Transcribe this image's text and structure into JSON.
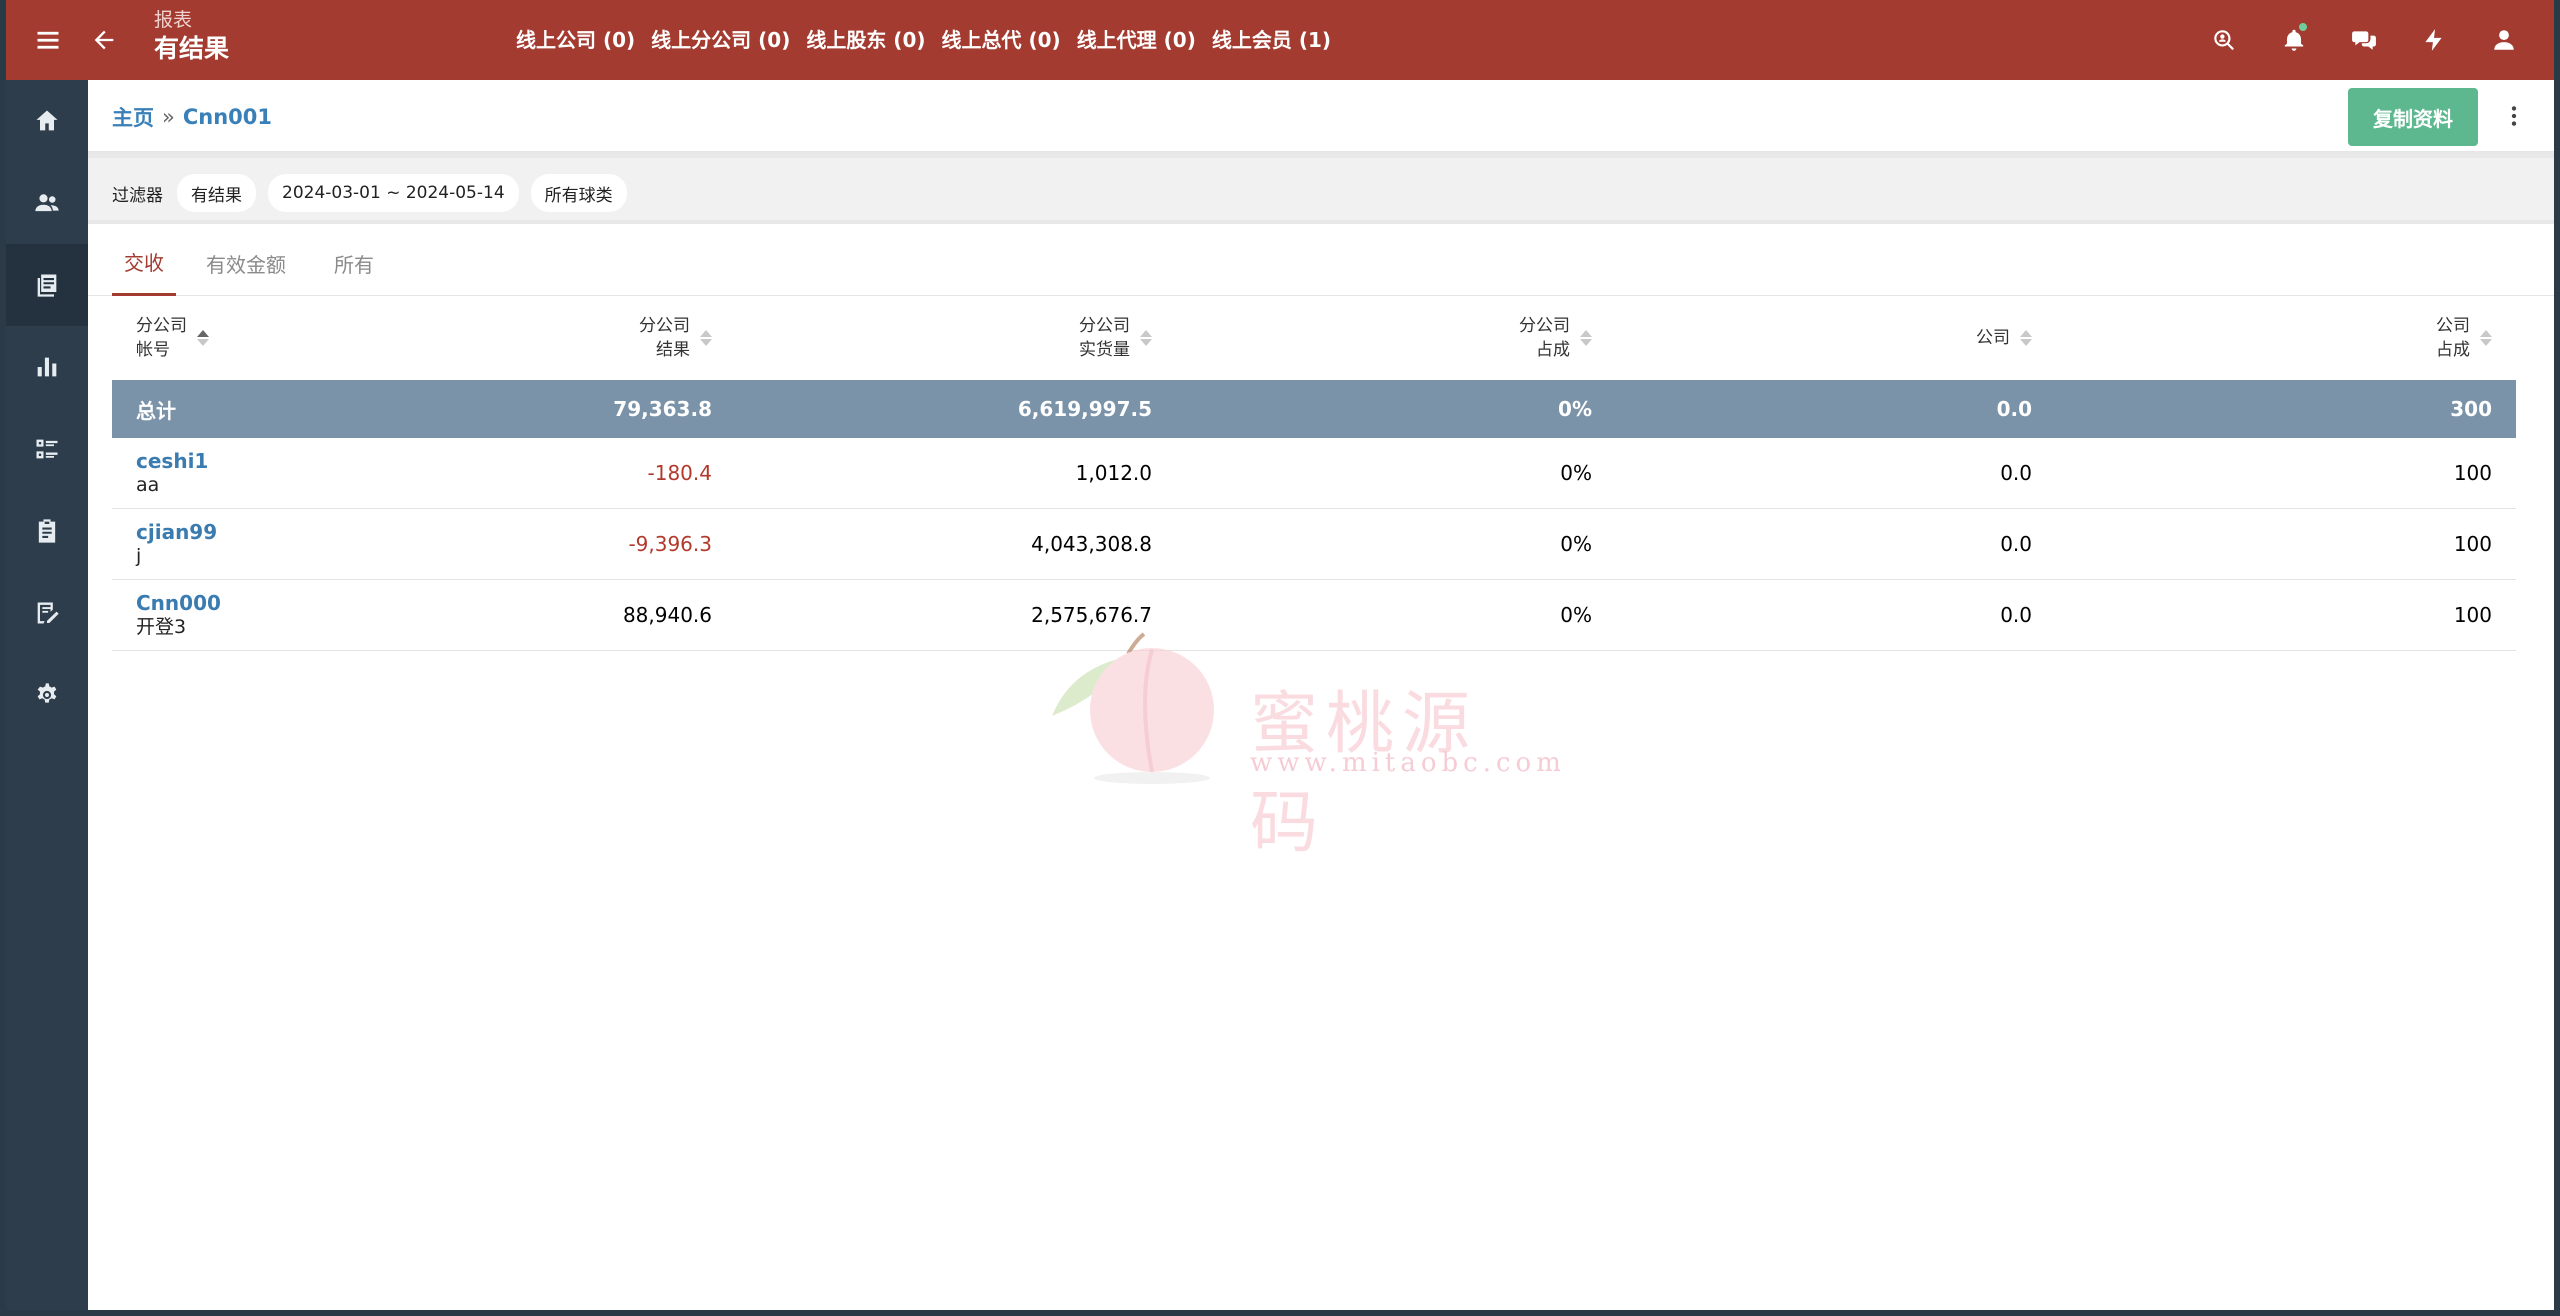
{
  "header": {
    "subtitle": "报表",
    "title": "有结果",
    "online": [
      {
        "label": "线上公司 (0)"
      },
      {
        "label": "线上分公司 (0)"
      },
      {
        "label": "线上股东 (0)"
      },
      {
        "label": "线上总代 (0)"
      },
      {
        "label": "线上代理 (0)"
      },
      {
        "label": "线上会员 (1)"
      }
    ]
  },
  "breadcrumb": {
    "home": "主页",
    "separator": "»",
    "current": "Cnn001"
  },
  "actions": {
    "copy_label": "复制资料"
  },
  "filter": {
    "label": "过滤器",
    "chips": [
      "有结果",
      "2024-03-01 ~ 2024-05-14",
      "所有球类"
    ]
  },
  "tabs": [
    {
      "label": "交收",
      "active": true
    },
    {
      "label": "有效金额",
      "active": false
    },
    {
      "label": "所有",
      "active": false
    }
  ],
  "table": {
    "headers": [
      {
        "line1": "分公司",
        "line2": "帐号"
      },
      {
        "line1": "分公司",
        "line2": "结果"
      },
      {
        "line1": "分公司",
        "line2": "实货量"
      },
      {
        "line1": "分公司",
        "line2": "占成"
      },
      {
        "line1": "公司",
        "line2": ""
      },
      {
        "line1": "公司",
        "line2": "占成"
      }
    ],
    "total": {
      "label": "总计",
      "result": "79,363.8",
      "volume": "6,619,997.5",
      "share": "0%",
      "company": "0.0",
      "company_share": "300"
    },
    "rows": [
      {
        "account": "ceshi1",
        "name": "aa",
        "result": "-180.4",
        "negative": true,
        "volume": "1,012.0",
        "share": "0%",
        "company": "0.0",
        "company_share": "100"
      },
      {
        "account": "cjian99",
        "name": "j",
        "result": "-9,396.3",
        "negative": true,
        "volume": "4,043,308.8",
        "share": "0%",
        "company": "0.0",
        "company_share": "100"
      },
      {
        "account": "Cnn000",
        "name": "开登3",
        "result": "88,940.6",
        "negative": false,
        "volume": "2,575,676.7",
        "share": "0%",
        "company": "0.0",
        "company_share": "100"
      }
    ]
  },
  "watermark": {
    "text": "蜜桃源码",
    "url": "www.mitaobc.com"
  },
  "colors": {
    "topbar": "#a33b30",
    "sidebar": "#2e3d4b",
    "accent_link": "#3a7bb0",
    "copy_button": "#5db88f",
    "total_row": "#7b93a8",
    "negative": "#b2392c"
  }
}
